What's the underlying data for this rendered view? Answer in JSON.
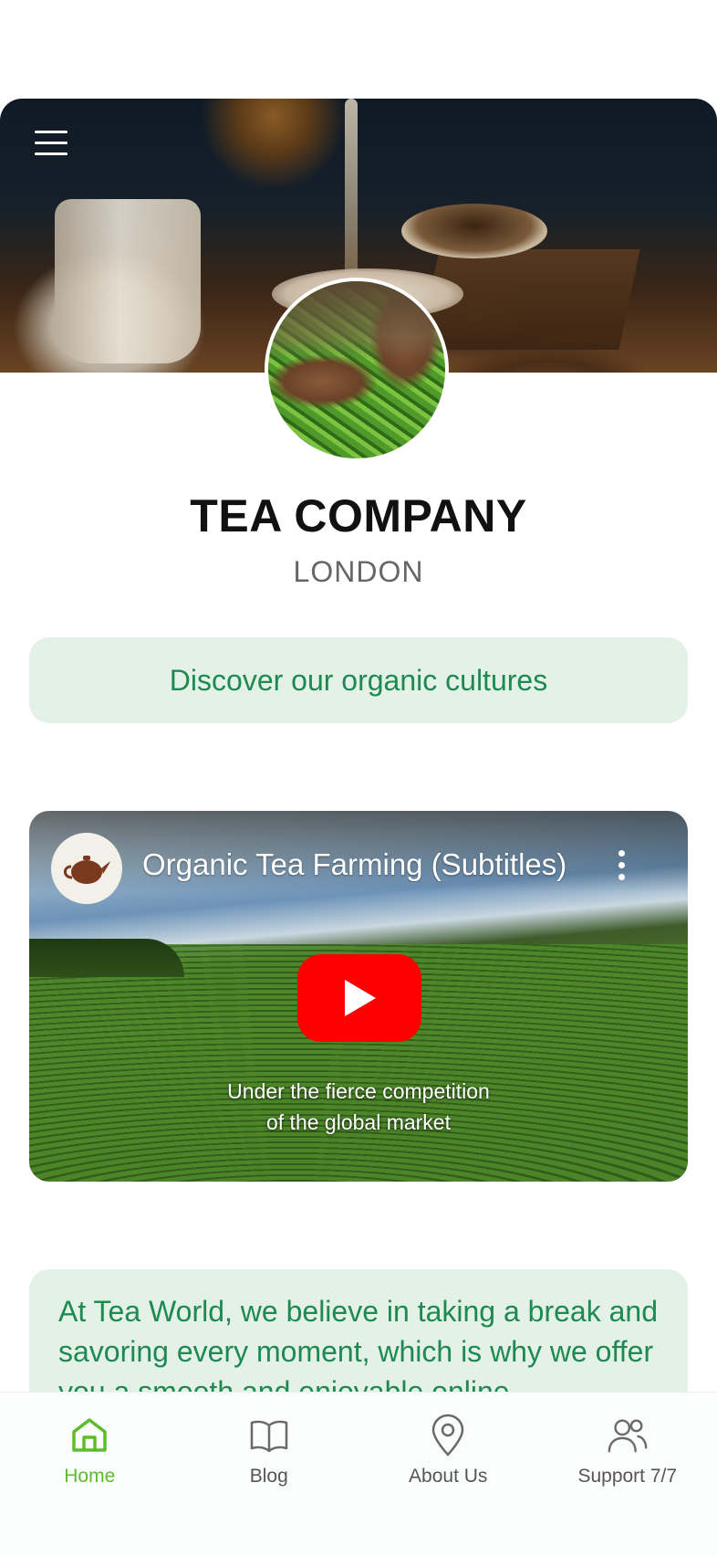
{
  "header": {
    "menu_icon": "hamburger-menu-icon"
  },
  "profile": {
    "name": "TEA COMPANY",
    "location": "LONDON"
  },
  "cta": {
    "label": "Discover our organic cultures"
  },
  "video": {
    "title": "Organic Tea Farming (Subtitles)",
    "caption_line1": "Under the fierce competition",
    "caption_line2": "of the global market",
    "play_icon": "youtube-play-icon",
    "more_icon": "more-vertical-icon"
  },
  "description": {
    "text": "At Tea World, we believe in taking a break and savoring every moment, which is why we offer you a smooth and enjoyable online"
  },
  "nav": {
    "items": [
      {
        "label": "Home",
        "icon": "home-icon",
        "active": true
      },
      {
        "label": "Blog",
        "icon": "book-icon",
        "active": false
      },
      {
        "label": "About Us",
        "icon": "map-pin-icon",
        "active": false
      },
      {
        "label": "Support 7/7",
        "icon": "users-icon",
        "active": false
      }
    ]
  },
  "colors": {
    "accent_green": "#1e8a52",
    "light_green_bg": "#e3f1e7",
    "nav_active": "#5cbd2a",
    "youtube_red": "#ff0000"
  }
}
